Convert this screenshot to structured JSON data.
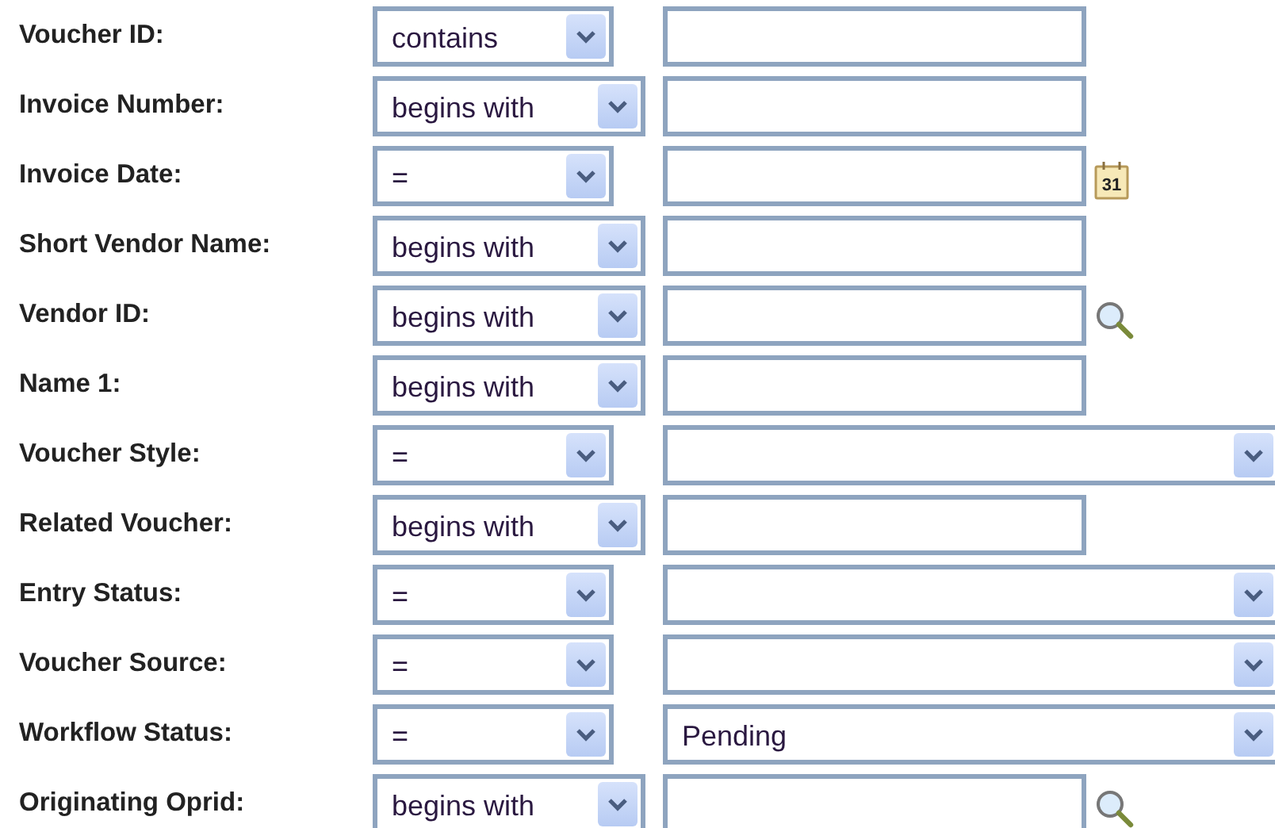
{
  "fields": [
    {
      "label": "Voucher ID:",
      "operator": "contains",
      "kind": "text"
    },
    {
      "label": "Invoice Number:",
      "operator": "begins with",
      "kind": "text"
    },
    {
      "label": "Invoice Date:",
      "operator": "=",
      "kind": "date",
      "icon_text": "31"
    },
    {
      "label": "Short Vendor Name:",
      "operator": "begins with",
      "kind": "text"
    },
    {
      "label": "Vendor ID:",
      "operator": "begins with",
      "kind": "lookup"
    },
    {
      "label": "Name 1:",
      "operator": "begins with",
      "kind": "text"
    },
    {
      "label": "Voucher Style:",
      "operator": "=",
      "kind": "dropdown"
    },
    {
      "label": "Related Voucher:",
      "operator": "begins with",
      "kind": "text"
    },
    {
      "label": "Entry Status:",
      "operator": "=",
      "kind": "dropdown"
    },
    {
      "label": "Voucher Source:",
      "operator": "=",
      "kind": "dropdown"
    },
    {
      "label": "Workflow Status:",
      "operator": "=",
      "kind": "dropdown",
      "value": "Pending"
    },
    {
      "label": "Originating Oprid:",
      "operator": "begins with",
      "kind": "lookup"
    }
  ]
}
